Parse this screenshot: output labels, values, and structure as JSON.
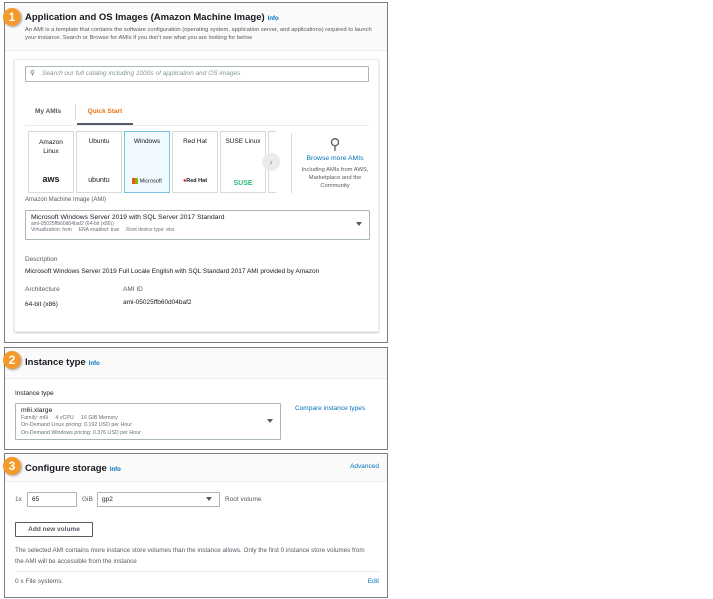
{
  "ami": {
    "step": "1",
    "title": "Application and OS Images (Amazon Machine Image)",
    "info": "Info",
    "description": "An AMI is a template that contains the software configuration (operating system, application server, and applications) required to launch your instance. Search or Browse for AMIs if you don't see what you are looking for below",
    "search_placeholder": "Search our full catalog including 1000s of application and OS images",
    "tabs": [
      {
        "label": "My AMIs"
      },
      {
        "label": "Quick Start"
      }
    ],
    "tiles": [
      {
        "name": "Amazon Linux",
        "logo": "aws"
      },
      {
        "name": "Ubuntu",
        "logo": "ubuntu"
      },
      {
        "name": "Windows",
        "logo": "Microsoft"
      },
      {
        "name": "Red Hat",
        "logo": "Red Hat"
      },
      {
        "name": "SUSE Linux",
        "logo": "SUSE"
      }
    ],
    "browse_label": "Browse more AMIs",
    "browse_sub": "Including AMIs from AWS, Marketplace and the Community",
    "select_label": "Amazon Machine Image (AMI)",
    "selected_name": "Microsoft Windows Server 2019 with SQL Server 2017 Standard",
    "selected_id": "ami-05025ffb60d04baf2 (64-bit (x86))",
    "selected_meta": "Virtualization: hvm     ENA enabled: true     Root device type: ebs",
    "desc_label": "Description",
    "desc_value": "Microsoft Windows Server 2019 Full Locale English with SQL Standard 2017 AMI provided by Amazon",
    "arch_label": "Architecture",
    "arch_value": "64-bit (x86)",
    "amiid_label": "AMI ID",
    "amiid_value": "ami-05025ffb60d04baf2"
  },
  "instance": {
    "step": "2",
    "title": "Instance type",
    "info": "Info",
    "label": "Instance type",
    "value": "m6i.xlarge",
    "family": "Family: m6i     4 vCPU     16 GiB Memory",
    "linux": "On-Demand Linux pricing: 0.192 USD per Hour",
    "windows": "On-Demand Windows pricing: 0.376 USD per Hour",
    "compare": "Compare instance types"
  },
  "storage": {
    "step": "3",
    "title": "Configure storage",
    "info": "Info",
    "advanced": "Advanced",
    "count": "1x",
    "size": "65",
    "unit": "GiB",
    "type": "gp2",
    "root": "Root volume",
    "add": "Add new volume",
    "note": "The selected AMI contains more instance store volumes than the instance allows. Only the first 0 instance store volumes from the AMI will be accessible from the instance",
    "fs": "0 x File systems",
    "edit": "Edit"
  }
}
